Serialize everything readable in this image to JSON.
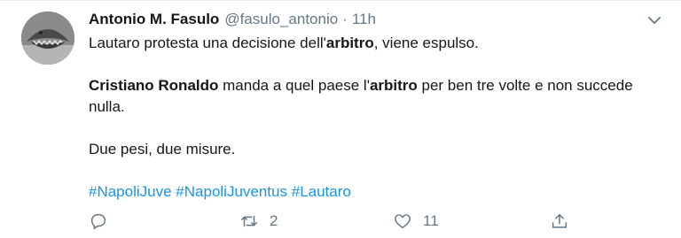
{
  "tweet": {
    "author_name": "Antonio M. Fasulo",
    "handle": "@fasulo_antonio",
    "separator": "·",
    "time": "11h",
    "line1": {
      "pre": "Lautaro protesta una decisione dell'",
      "bold": "arbitro",
      "post": ", viene espulso."
    },
    "line2": {
      "bold1": "Cristiano Ronaldo",
      "mid": " manda a quel paese l'",
      "bold2": "arbitro",
      "post": " per ben tre volte e non succede nulla."
    },
    "line3": "Due pesi, due misure.",
    "hashtags": [
      "#NapoliJuve",
      "#NapoliJuventus",
      "#Lautaro"
    ]
  },
  "actions": {
    "retweet_count": "2",
    "like_count": "11"
  },
  "icons": {
    "reply": "reply-icon",
    "retweet": "retweet-icon",
    "like": "heart-icon",
    "share": "share-icon",
    "more": "chevron-down-icon"
  },
  "colors": {
    "link": "#1b95e0",
    "muted": "#657786",
    "text": "#14171a"
  }
}
